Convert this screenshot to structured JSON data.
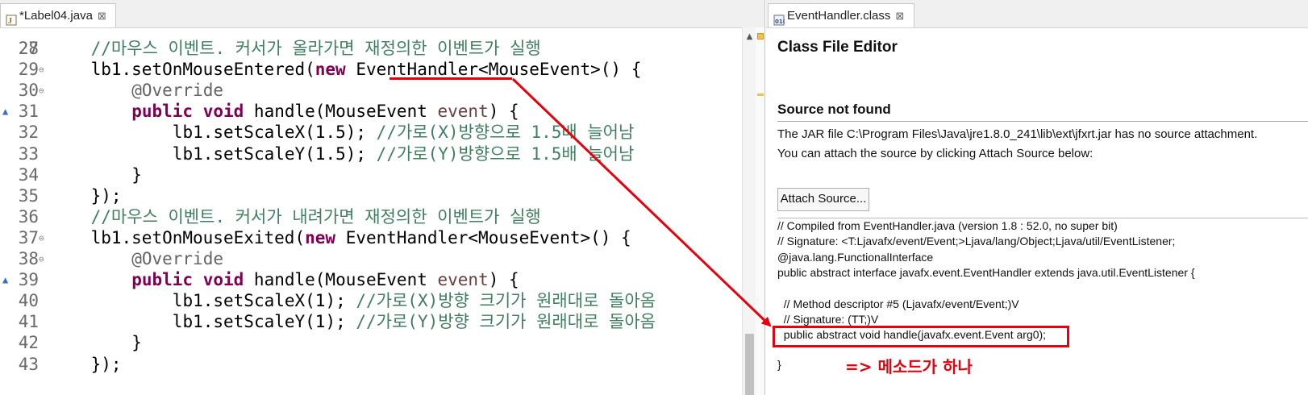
{
  "left_editor": {
    "tab_title": "*Label04.java",
    "tab_close": "⊠",
    "partial_line_number": "27",
    "lines": [
      {
        "num": "28",
        "text": "//마우스 이벤트. 커서가 올라가면 재정의한 이벤트가 실행"
      },
      {
        "num": "29",
        "text": "lb1.setOnMouseEntered(new EventHandler<MouseEvent>() {"
      },
      {
        "num": "30",
        "text": "@Override"
      },
      {
        "num": "31",
        "text": "public void handle(MouseEvent event) {"
      },
      {
        "num": "32",
        "text": "lb1.setScaleX(1.5); //가로(X)방향으로 1.5배 늘어남"
      },
      {
        "num": "33",
        "text": "lb1.setScaleY(1.5); //가로(Y)방향으로 1.5배 늘어남"
      },
      {
        "num": "34",
        "text": "}"
      },
      {
        "num": "35",
        "text": "});"
      },
      {
        "num": "36",
        "text": "//마우스 이벤트. 커서가 내려가면 재정의한 이벤트가 실행"
      },
      {
        "num": "37",
        "text": "lb1.setOnMouseExited(new EventHandler<MouseEvent>() {"
      },
      {
        "num": "38",
        "text": "@Override"
      },
      {
        "num": "39",
        "text": "public void handle(MouseEvent event) {"
      },
      {
        "num": "40",
        "text": "lb1.setScaleX(1); //가로(X)방향 크기가 원래대로 돌아옴"
      },
      {
        "num": "41",
        "text": "lb1.setScaleY(1); //가로(Y)방향 크기가 원래대로 돌아옴"
      },
      {
        "num": "42",
        "text": "}"
      },
      {
        "num": "43",
        "text": "});"
      }
    ]
  },
  "right_editor": {
    "tab_title": "EventHandler.class",
    "tab_close": "⊠",
    "editor_title": "Class File Editor",
    "source_heading": "Source not found",
    "message_line1": "The JAR file C:\\Program Files\\Java\\jre1.8.0_241\\lib\\ext\\jfxrt.jar has no source attachment.",
    "message_line2": "You can attach the source by clicking Attach Source below:",
    "attach_button": "Attach Source...",
    "bytecode": [
      "// Compiled from EventHandler.java (version 1.8 : 52.0, no super bit)",
      "// Signature: <T:Ljavafx/event/Event;>Ljava/lang/Object;Ljava/util/EventListener;",
      "@java.lang.FunctionalInterface",
      "public abstract interface javafx.event.EventHandler extends java.util.EventListener {",
      "",
      "  // Method descriptor #5 (Ljavafx/event/Event;)V",
      "  // Signature: (TT;)V",
      "  public abstract void handle(javafx.event.Event arg0);",
      "}"
    ],
    "annotation_note": "=> 메소드가 하나"
  },
  "colors": {
    "keyword": "#7f0055",
    "comment": "#3f7f5f",
    "annotation": "#646464",
    "highlight_red": "#e8000d"
  }
}
